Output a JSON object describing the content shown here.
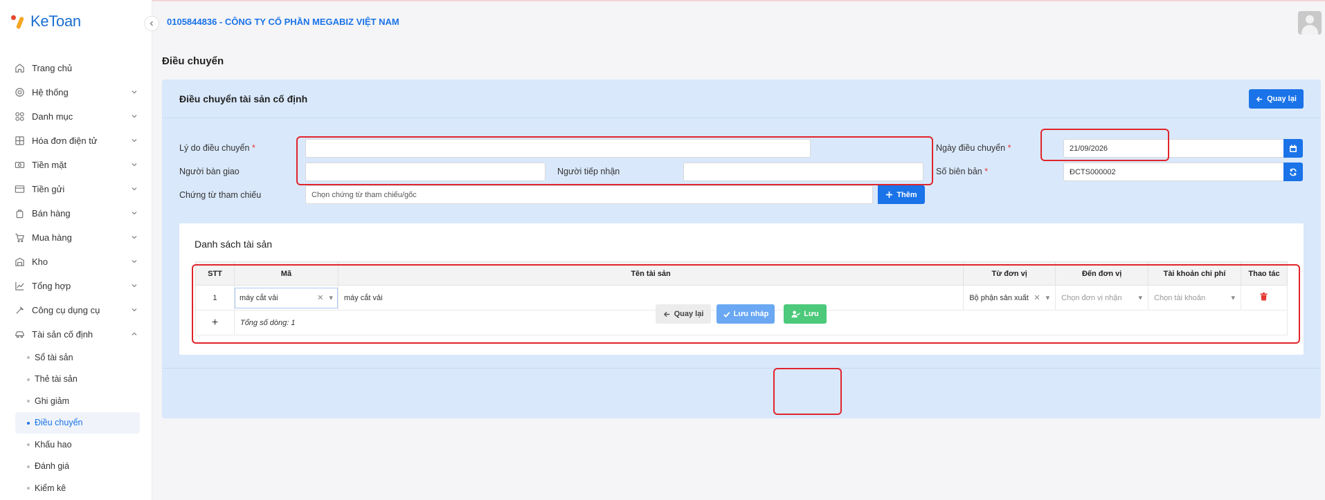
{
  "brand": {
    "name": "KeToan"
  },
  "header": {
    "company": "0105844836 - CÔNG TY CỔ PHẦN MEGABIZ VIỆT NAM"
  },
  "sidebar": {
    "items": [
      {
        "label": "Trang chủ",
        "icon": "home-icon"
      },
      {
        "label": "Hệ thống",
        "icon": "gear-icon"
      },
      {
        "label": "Danh mục",
        "icon": "grid-icon"
      },
      {
        "label": "Hóa đơn điện tử",
        "icon": "invoice-icon"
      },
      {
        "label": "Tiền mặt",
        "icon": "cash-icon"
      },
      {
        "label": "Tiền gửi",
        "icon": "bank-card-icon"
      },
      {
        "label": "Bán hàng",
        "icon": "bag-icon"
      },
      {
        "label": "Mua hàng",
        "icon": "cart-icon"
      },
      {
        "label": "Kho",
        "icon": "warehouse-icon"
      },
      {
        "label": "Tổng hợp",
        "icon": "chart-line-icon"
      },
      {
        "label": "Công cụ dụng cụ",
        "icon": "tools-icon"
      },
      {
        "label": "Tài sản cố định",
        "icon": "car-icon"
      }
    ],
    "subitems": [
      "Sổ tài sản",
      "Thẻ tài sản",
      "Ghi giảm",
      "Điều chuyển",
      "Khấu hao",
      "Đánh giá",
      "Kiểm kê"
    ]
  },
  "page": {
    "title": "Điều chuyển"
  },
  "form": {
    "title": "Điều chuyển tài sản cố định",
    "back_top": "Quay lại",
    "reason_label": "Lý do điều chuyển",
    "reason_value": "",
    "handover_label": "Người bàn giao",
    "handover_value": "",
    "receiver_label": "Người tiếp nhận",
    "receiver_value": "",
    "ref_label": "Chứng từ tham chiếu",
    "ref_placeholder": "Chọn chứng từ tham chiếu/gốc",
    "add_label": "Thêm",
    "date_label": "Ngày điều chuyển",
    "date_value": "21/09/2026",
    "record_label": "Số biên bản",
    "record_value": "ĐCTS000002"
  },
  "assets": {
    "title": "Danh sách tài sản",
    "columns": [
      "STT",
      "Mã",
      "Tên tài sản",
      "Từ đơn vị",
      "Đến đơn vị",
      "Tài khoản chi phí",
      "Thao tác"
    ],
    "rows": [
      {
        "stt": "1",
        "ma": "máy cắt vải",
        "ten": "máy cắt vải",
        "tu_don_vi": "Bộ phận sản xuất",
        "den_don_vi_placeholder": "Chọn đơn vị nhận",
        "tai_khoan_placeholder": "Chọn tài khoản"
      }
    ],
    "total": "Tổng số dòng: 1"
  },
  "footer": {
    "back": "Quay lại",
    "draft": "Lưu nháp",
    "save": "Lưu"
  },
  "colors": {
    "primary": "#1a73e8",
    "panel": "#d9e8fb",
    "save": "#4cc97a",
    "draft": "#6aa8f3",
    "highlight": "#e0242b"
  }
}
